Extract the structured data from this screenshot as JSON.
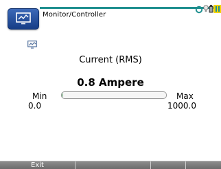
{
  "header": {
    "title": "Monitor/Controller",
    "app_icon": "monitor-icon",
    "status_icons": [
      "connection-icon",
      "lightbulb-icon",
      "battery-icon",
      "warning-icon"
    ]
  },
  "meter": {
    "icon": "monitor-small-icon",
    "label": "Current (RMS)",
    "value": "0.8 Ampere",
    "min_label": "Min",
    "min_value": "0.0",
    "max_label": "Max",
    "max_value": "1000.0",
    "level_fraction": 0.0008
  },
  "softkeys": [
    "Exit",
    "",
    "",
    ""
  ],
  "colors": {
    "accent": "#1f8f8f",
    "app_button": "#2a56a3",
    "softkey_bar": "#7a7a7a",
    "bar_fill": "#2b8a3e"
  }
}
